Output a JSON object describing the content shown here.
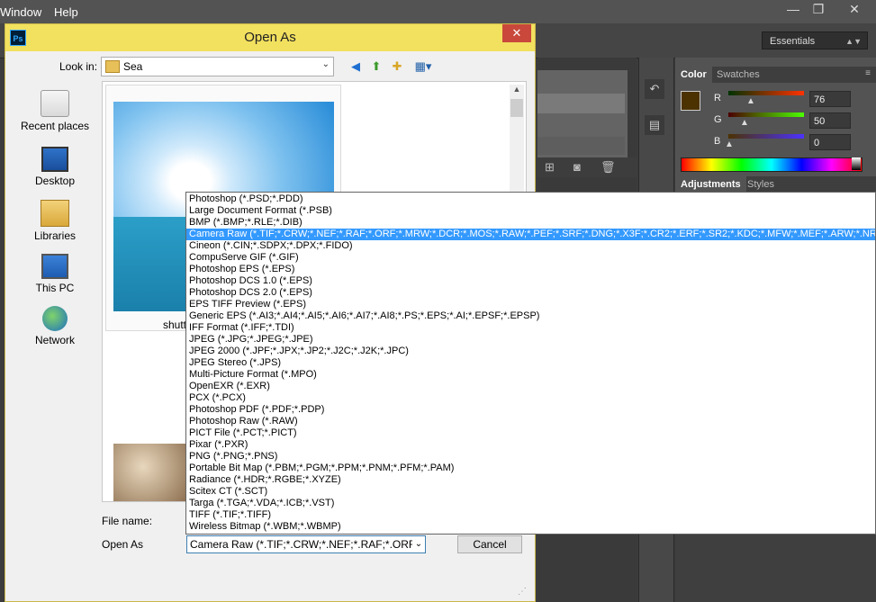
{
  "ps": {
    "menu": [
      "Window",
      "Help"
    ],
    "window_controls": [
      "—",
      "❐",
      "✕"
    ],
    "workspace": "Essentials",
    "color_tabs": [
      "Color",
      "Swatches"
    ],
    "sliders": [
      {
        "label": "R",
        "value": "76"
      },
      {
        "label": "G",
        "value": "50"
      },
      {
        "label": "B",
        "value": "0"
      }
    ],
    "lower_tabs": [
      "Adjustments",
      "Styles"
    ],
    "swatch_color": "#4c3200"
  },
  "dialog": {
    "title": "Open As",
    "ps_badge": "Ps",
    "close_glyph": "✕",
    "look_in_label": "Look in:",
    "look_in_value": "Sea",
    "places": [
      "Recent places",
      "Desktop",
      "Libraries",
      "This PC",
      "Network"
    ],
    "thumbnail_name": "shutt",
    "file_name_label": "File name:",
    "open_as_label": "Open As",
    "open_as_value": "Camera Raw (*.TIF;*.CRW;*.NEF;*.RAF;*.ORF;*.MR",
    "cancel_label": "Cancel"
  },
  "dropdown": {
    "selected_index": 3,
    "items": [
      "Photoshop (*.PSD;*.PDD)",
      "Large Document Format (*.PSB)",
      "BMP (*.BMP;*.RLE;*.DIB)",
      "Camera Raw (*.TIF;*.CRW;*.NEF;*.RAF;*.ORF;*.MRW;*.DCR;*.MOS;*.RAW;*.PEF;*.SRF;*.DNG;*.X3F;*.CR2;*.ERF;*.SR2;*.KDC;*.MFW;*.MEF;*.ARW;*.NRW;*.",
      "Cineon (*.CIN;*.SDPX;*.DPX;*.FIDO)",
      "CompuServe GIF (*.GIF)",
      "Photoshop EPS (*.EPS)",
      "Photoshop DCS 1.0 (*.EPS)",
      "Photoshop DCS 2.0 (*.EPS)",
      "EPS TIFF Preview (*.EPS)",
      "Generic EPS (*.AI3;*.AI4;*.AI5;*.AI6;*.AI7;*.AI8;*.PS;*.EPS;*.AI;*.EPSF;*.EPSP)",
      "IFF Format (*.IFF;*.TDI)",
      "JPEG (*.JPG;*.JPEG;*.JPE)",
      "JPEG 2000 (*.JPF;*.JPX;*.JP2;*.J2C;*.J2K;*.JPC)",
      "JPEG Stereo (*.JPS)",
      "Multi-Picture Format (*.MPO)",
      "OpenEXR (*.EXR)",
      "PCX (*.PCX)",
      "Photoshop PDF (*.PDF;*.PDP)",
      "Photoshop Raw (*.RAW)",
      "PICT File (*.PCT;*.PICT)",
      "Pixar (*.PXR)",
      "PNG (*.PNG;*.PNS)",
      "Portable Bit Map (*.PBM;*.PGM;*.PPM;*.PNM;*.PFM;*.PAM)",
      "Radiance (*.HDR;*.RGBE;*.XYZE)",
      "Scitex CT (*.SCT)",
      "Targa (*.TGA;*.VDA;*.ICB;*.VST)",
      "TIFF (*.TIF;*.TIFF)",
      "Wireless Bitmap (*.WBM;*.WBMP)"
    ]
  }
}
